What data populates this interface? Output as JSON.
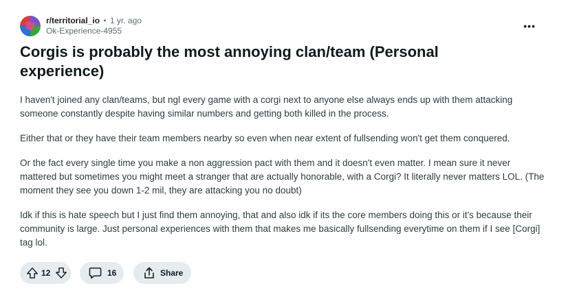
{
  "post": {
    "subreddit": "r/territorial_io",
    "separator": "•",
    "time_ago": "1 yr. ago",
    "author": "Ok-Experience-4955",
    "more_label": "•••",
    "title": "Corgis is probably the most annoying clan/team (Personal experience)",
    "paragraphs": [
      "I haven't joined any clan/teams, but ngl every game with a corgi next to anyone else always ends up with them attacking someone constantly despite having similar numbers and getting both killed in the process.",
      "Either that or they have their team members nearby so even when near extent of fullsending won't get them conquered.",
      "Or the fact every single time you make a non aggression pact with them and it doesn't even matter. I mean sure it never mattered but sometimes you might meet a stranger that are actually honorable, with a Corgi? It literally never matters LOL. (The moment they see you down 1-2 mil, they are attacking you no doubt)",
      "Idk if this is hate speech but I just find them annoying, that and also idk if its the core members doing this or it's because their community is large. Just personal experiences with them that makes me basically fullsending everytime on them if I see [Corgi] tag lol."
    ]
  },
  "actions": {
    "vote_count": "12",
    "comment_count": "16",
    "share_label": "Share"
  },
  "icons": {
    "avatar": "subreddit-avatar-icon",
    "upvote": "upvote-icon",
    "downvote": "downvote-icon",
    "comment": "comment-icon",
    "share": "share-icon"
  }
}
